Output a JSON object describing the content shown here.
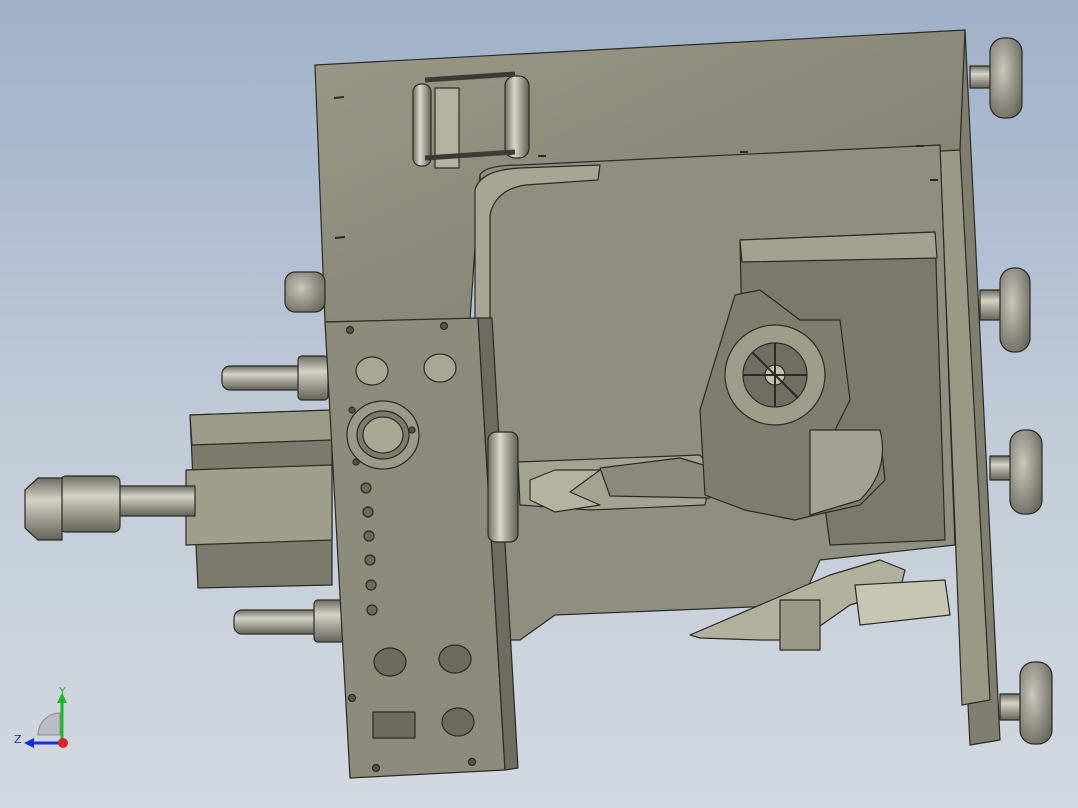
{
  "view": {
    "background_top": "#9fb0c8",
    "background_bottom": "#d3d9e0",
    "model_color": "#8d8c7c",
    "edge_color": "#2a2a26"
  },
  "triad": {
    "y_label": "Y",
    "z_label": "Z",
    "x_color": "#e0202a",
    "y_color": "#1fb52a",
    "z_color": "#1a2bd8"
  }
}
